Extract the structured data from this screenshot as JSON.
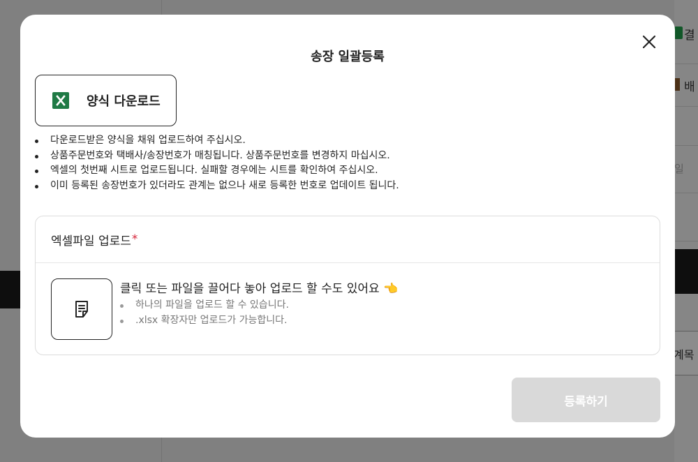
{
  "background": {
    "right_texts": [
      "결",
      "배",
      "일",
      "계목"
    ]
  },
  "modal": {
    "title": "송장 일괄등록",
    "close_icon": "close-icon",
    "download_button": {
      "label": "양식 다운로드",
      "icon": "excel-icon",
      "icon_color": "#1f7a45"
    },
    "notes": [
      "다운로드받은 양식을 채워 업로드하여 주십시오.",
      "상품주문번호와 택배사/송장번호가 매칭됩니다. 상품주문번호를 변경하지 마십시오.",
      "엑셀의 첫번째 시트로 업로드됩니다. 실패할 경우에는 시트를 확인하여 주십시오.",
      "이미 등록된 송장번호가 있더라도 관계는 없으나 새로 등록한 번호로 업데이트 됩니다."
    ],
    "upload": {
      "label": "엑셀파일 업로드",
      "required_mark": "*",
      "file_icon": "document-icon",
      "main_text": "클릭 또는 파일을 끌어다 놓아 업로드 할 수도 있어요 👈",
      "hints": [
        "하나의 파일을 업로드 할 수 있습니다.",
        ".xlsx 확장자만 업로드가 가능합니다."
      ]
    },
    "submit_label": "등록하기"
  }
}
